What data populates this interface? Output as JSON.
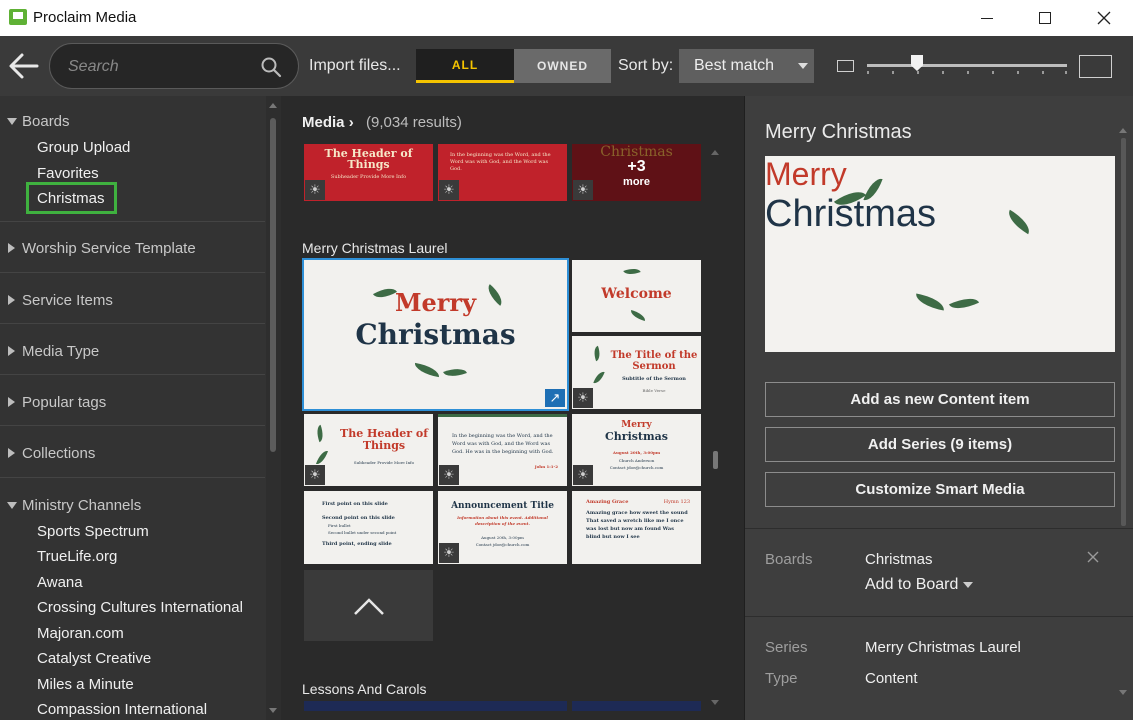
{
  "window": {
    "title": "Proclaim Media",
    "icon": "proclaim-app-icon",
    "controls": [
      "minimize-icon",
      "maximize-icon",
      "close-icon"
    ]
  },
  "toolbar": {
    "back_icon": "arrow-left-icon",
    "search_placeholder": "Search",
    "search_icon": "search-icon",
    "import_label": "Import files...",
    "filter_all": "ALL",
    "filter_owned": "OWNED",
    "filter_selected": "ALL",
    "sort_label": "Sort by:",
    "sort_value": "Best match",
    "accent_color": "#f5c400",
    "thumb_size_level": 0.25
  },
  "sidebar": {
    "boards_heading": "Boards",
    "boards": [
      "Group Upload",
      "Favorites",
      "Christmas"
    ],
    "selected_board": "Christmas",
    "sections": [
      "Worship Service Template",
      "Service Items",
      "Media Type",
      "Popular tags",
      "Collections"
    ],
    "ministry_heading": "Ministry Channels",
    "ministry_channels": [
      "Sports Spectrum",
      "TrueLife.org",
      "Awana",
      "Crossing Cultures International",
      "Majoran.com",
      "Catalyst Creative",
      "Miles a Minute",
      "Compassion International"
    ],
    "selection_color": "#3fb13f"
  },
  "media": {
    "breadcrumb": "Media",
    "breadcrumb_chevron": "›",
    "results": "(9,034 results)",
    "top_row": {
      "tile1_title": "The Header of Things",
      "tile1_sub": "Subheader Provide More Info",
      "tile2_text": "In the beginning was the Word, and the Word was with God, and the Word was God.",
      "tile3_title": "Christmas",
      "more_count": "+3",
      "more_word": "more"
    },
    "group1_title": "Merry Christmas Laurel",
    "group1": {
      "main_line1": "Merry",
      "main_line2": "Christmas",
      "welcome": "Welcome",
      "sermon_title": "The Title of the Sermon",
      "sermon_sub": "Subtitle of the Sermon",
      "sermon_extra": "Bible Verse",
      "header_title": "The Header of Things",
      "header_sub": "Subheader Provide More Info",
      "verse_text": "In the beginning was the Word, and the Word was with God, and the Word was God. He was in the beginning with God.",
      "verse_ref": "John 1:1-2",
      "mc_line1": "Merry",
      "mc_line2": "Christmas",
      "mc_date": "August 20th, 3:00pm",
      "mc_info1": "Church Anderson",
      "mc_info2": "Contact jdoe@church.com",
      "points_1": "First point on this slide",
      "points_2": "Second point on this slide",
      "points_3": "First bullet",
      "points_4": "Second bullet under second point",
      "points_5": "Third point, ending slide",
      "ann_title": "Announcement Title",
      "ann_sub": "Information about this event. Additional description of the event.",
      "ann_date": "August 20th, 3:00pm",
      "ann_contact": "Contact jdoe@church.com",
      "song_title": "Amazing Grace",
      "song_num": "Hymn 123",
      "song_lines": "Amazing grace how sweet the sound That saved a wretch like me I once was lost but now am found Was blind but now I see"
    },
    "group2_title": "Lessons And Carols",
    "up_icon": "chevron-up-icon",
    "bulb_icon": "lightbulb-icon",
    "expand_icon": "expand-arrow-icon"
  },
  "detail": {
    "title": "Merry Christmas",
    "preview_line1": "Merry",
    "preview_line2": "Christmas",
    "btn_add_content": "Add as new Content item",
    "btn_add_series": "Add Series (9 items)",
    "btn_customize": "Customize Smart Media",
    "boards_label": "Boards",
    "boards_value": "Christmas",
    "add_to_board": "Add to Board",
    "series_label": "Series",
    "series_value": "Merry Christmas Laurel",
    "type_label": "Type",
    "type_value": "Content"
  },
  "colors": {
    "christmas_red": "#c23a2a",
    "christmas_navy": "#1f3447",
    "leaf_green": "#3d6b45"
  }
}
